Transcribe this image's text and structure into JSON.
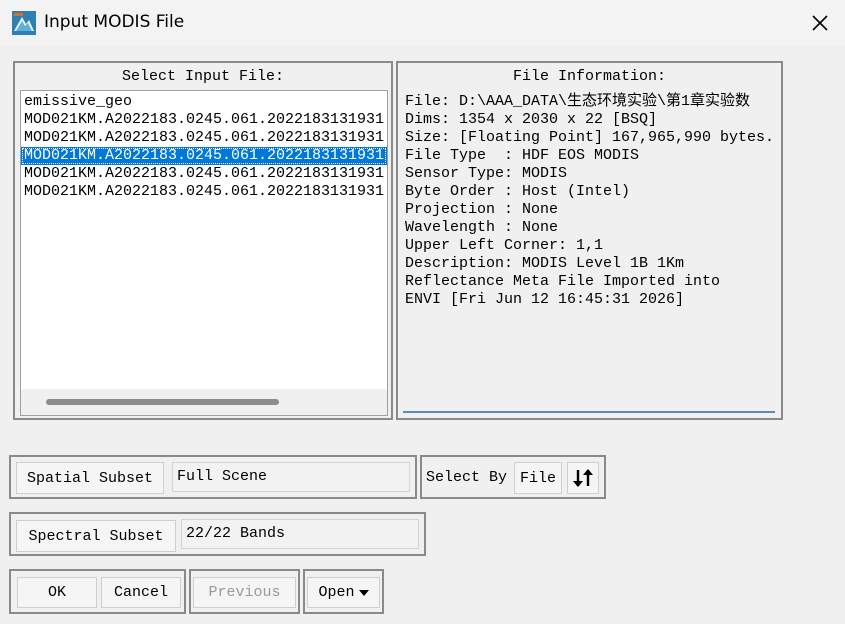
{
  "window": {
    "title": "Input MODIS File",
    "close_icon": "close-icon",
    "app_icon": "envi-app-icon"
  },
  "select_input": {
    "title": "Select Input File:",
    "files": [
      "emissive_geo",
      "MOD021KM.A2022183.0245.061.2022183131931",
      "MOD021KM.A2022183.0245.061.2022183131931",
      "MOD021KM.A2022183.0245.061.2022183131931",
      "MOD021KM.A2022183.0245.061.2022183131931",
      "MOD021KM.A2022183.0245.061.2022183131931"
    ],
    "selected_index": 3
  },
  "file_info": {
    "title": "File Information:",
    "lines": [
      "File: D:\\AAA_DATA\\生态环境实验\\第1章实验数",
      "Dims: 1354 x 2030 x 22 [BSQ]",
      "Size: [Floating Point] 167,965,990 bytes.",
      "File Type  : HDF EOS MODIS",
      "Sensor Type: MODIS",
      "Byte Order : Host (Intel)",
      "Projection : None",
      "Wavelength : None",
      "Upper Left Corner: 1,1",
      "Description: MODIS Level 1B 1Km",
      "Reflectance Meta File Imported into",
      "ENVI [Fri Jun 12 16:45:31 2026]"
    ]
  },
  "spatial": {
    "button_label": "Spatial Subset",
    "value": "Full Scene"
  },
  "select_by": {
    "label": "Select By",
    "button_label": "File",
    "sort_icon": "sort-arrows-icon"
  },
  "spectral": {
    "button_label": "Spectral Subset",
    "value": "22/22 Bands"
  },
  "actions": {
    "ok": "OK",
    "cancel": "Cancel",
    "previous": "Previous",
    "open": "Open"
  }
}
